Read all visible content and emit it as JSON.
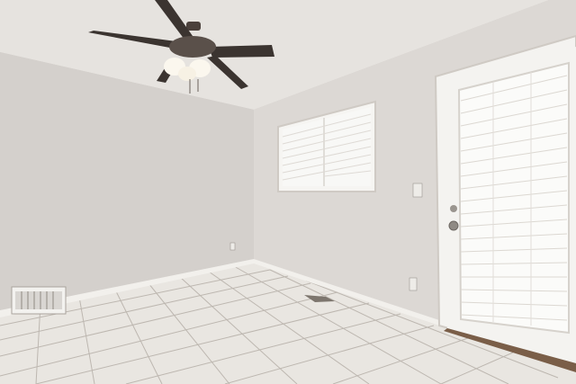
{
  "scene": {
    "description_tag": "empty-room-photo",
    "colors": {
      "ceiling": "#e6e3df",
      "left_wall": "#d4d0cc",
      "right_wall": "#dcd8d4",
      "floor_tile": "#e9e6e1",
      "grout": "#bdb7b0",
      "baseboard": "#f2f0ec",
      "door": "#f4f3f0",
      "blinds": "#f7f7f5",
      "fan_blade": "#3b3430",
      "fan_light": "#fbf7ee",
      "threshold": "#7a5e48"
    }
  }
}
